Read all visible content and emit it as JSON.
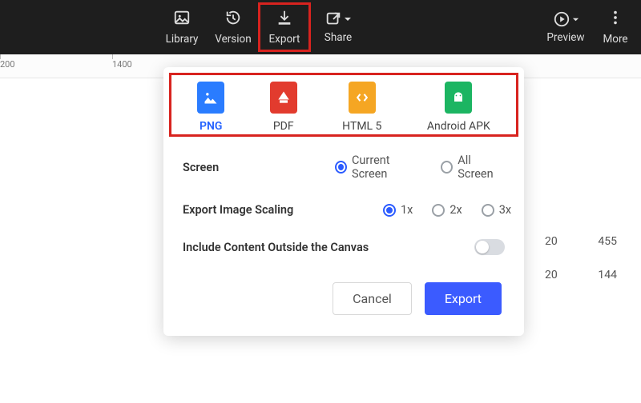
{
  "toolbar": {
    "library": "Library",
    "version": "Version",
    "export": "Export",
    "share": "Share",
    "preview": "Preview",
    "more": "More"
  },
  "ruler": {
    "t1": "200",
    "t2": "1400"
  },
  "formats": {
    "png": "PNG",
    "pdf": "PDF",
    "html5": "HTML 5",
    "apk": "Android APK"
  },
  "options": {
    "screen_label": "Screen",
    "screen_current": "Current Screen",
    "screen_all": "All Screen",
    "scaling_label": "Export Image Scaling",
    "scale_1x": "1x",
    "scale_2x": "2x",
    "scale_3x": "3x",
    "include_outside": "Include Content Outside the Canvas"
  },
  "actions": {
    "cancel": "Cancel",
    "export": "Export"
  },
  "side": {
    "r1a": "20",
    "r1b": "455",
    "r2a": "20",
    "r2b": "144"
  }
}
